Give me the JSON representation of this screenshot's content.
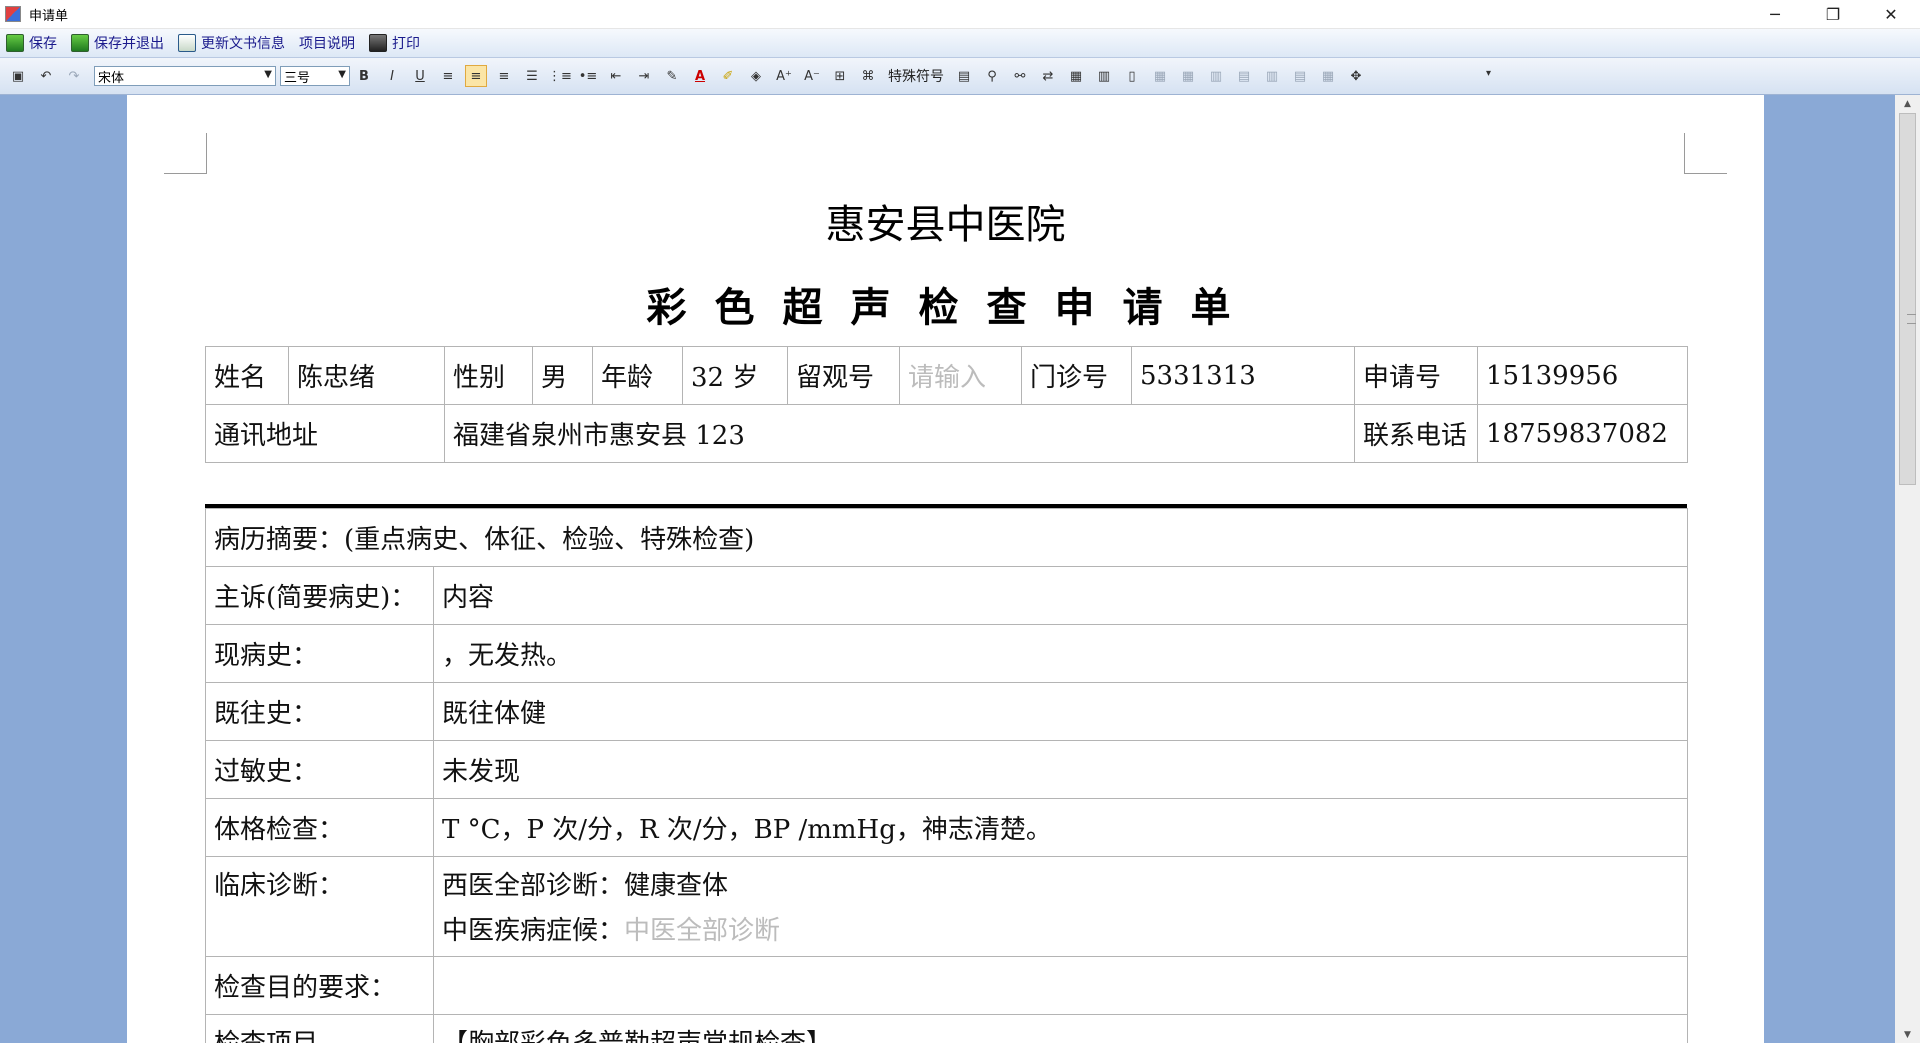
{
  "window": {
    "title": "申请单",
    "minimize": "─",
    "restore": "❐",
    "close": "✕"
  },
  "menubar": {
    "items": [
      "保存",
      "保存并退出",
      "更新文书信息",
      "项目说明",
      "打印"
    ]
  },
  "formatbar": {
    "font_name": "宋体",
    "font_size": "三号",
    "special_chars": "特殊符号"
  },
  "document": {
    "hospital": "惠安县中医院",
    "form_title": "彩色超声检查申请单",
    "patient": {
      "name_label": "姓名",
      "name": "陈忠绪",
      "sex_label": "性别",
      "sex": "男",
      "age_label": "年龄",
      "age": "32 岁",
      "obs_label": "留观号",
      "obs_placeholder": "请输入",
      "clinic_label": "门诊号",
      "clinic": "5331313",
      "apply_label": "申请号",
      "apply": "15139956",
      "address_label": "通讯地址",
      "address": "福建省泉州市惠安县 123",
      "phone_label": "联系电话",
      "phone": "18759837082"
    },
    "history": {
      "summary": "病历摘要：(重点病史、体征、检验、特殊检查)",
      "chief_label": "主诉(简要病史)：",
      "chief": "内容",
      "present_label": "现病史：",
      "present": "，无发热。",
      "past_label": "既往史：",
      "past": "既往体健",
      "allergy_label": "过敏史：",
      "allergy": "未发现",
      "exam_label": "体格检查：",
      "exam": "T  °C，P  次/分，R 次/分，BP  /mmHg，神志清楚。",
      "diag_label": "临床诊断：",
      "diag_west_label": "西医全部诊断：",
      "diag_west": "健康查体",
      "diag_tcm_label": "中医疾病症候：",
      "diag_tcm_placeholder": "中医全部诊断",
      "purpose_label": "检查目的要求：",
      "purpose": "",
      "item_label": "检查项目",
      "item": "【胸部彩色多普勒超声常规检查】"
    }
  }
}
